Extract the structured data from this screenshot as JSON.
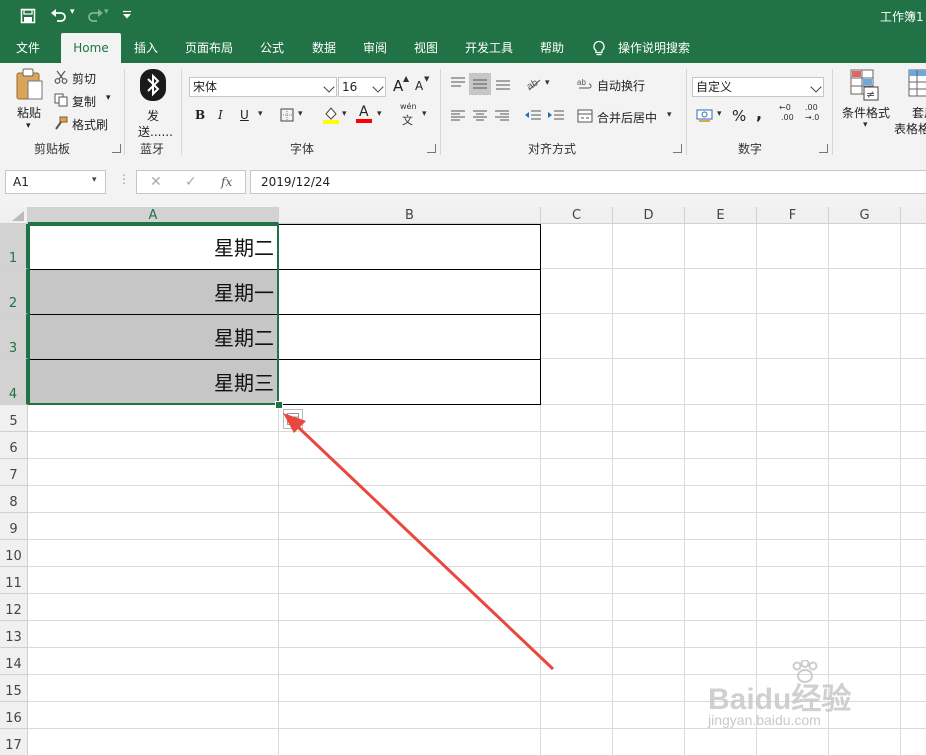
{
  "window": {
    "title": "工作簿1"
  },
  "quick_access": {
    "save_icon": "save-icon",
    "undo_icon": "undo-icon",
    "redo_icon": "redo-icon",
    "customize_icon": "customize-qat-icon"
  },
  "tabs": [
    {
      "label": "文件"
    },
    {
      "label": "Home"
    },
    {
      "label": "插入"
    },
    {
      "label": "页面布局"
    },
    {
      "label": "公式"
    },
    {
      "label": "数据"
    },
    {
      "label": "审阅"
    },
    {
      "label": "视图"
    },
    {
      "label": "开发工具"
    },
    {
      "label": "帮助"
    }
  ],
  "tell_me": {
    "label": "操作说明搜索",
    "icon": "lightbulb-icon"
  },
  "ribbon": {
    "clipboard": {
      "paste": "粘贴",
      "cut": "剪切",
      "copy": "复制",
      "format_painter": "格式刷",
      "group_label": "剪贴板"
    },
    "bluetooth": {
      "send_line1": "发",
      "send_line2": "送......",
      "group_label": "蓝牙"
    },
    "font": {
      "font_name": "宋体",
      "font_size": "16",
      "grow": "A",
      "shrink": "A",
      "bold": "B",
      "italic": "I",
      "underline": "U",
      "font_color_letter": "A",
      "phonetic_top": "wén",
      "phonetic_bottom": "文",
      "group_label": "字体",
      "fill_color": "#ffff00",
      "font_color": "#ff0000"
    },
    "alignment": {
      "wrap_text": "自动换行",
      "merge_center": "合并后居中",
      "group_label": "对齐方式"
    },
    "number": {
      "format": "自定义",
      "percent": "%",
      "comma": ",",
      "inc_decimal_top": "←0",
      "inc_decimal_bottom": ".00",
      "dec_decimal_top": ".00",
      "dec_decimal_bottom": "→.0",
      "group_label": "数字"
    },
    "styles": {
      "conditional_format": "条件格式",
      "format_as_table_line1": "套用",
      "format_as_table_line2": "表格格"
    }
  },
  "formula_bar": {
    "name_box": "A1",
    "cancel": "✕",
    "enter": "✓",
    "fx": "fx",
    "value": "2019/12/24"
  },
  "sheet": {
    "columns": [
      "A",
      "B",
      "C",
      "D",
      "E",
      "F",
      "G"
    ],
    "rows": [
      "1",
      "2",
      "3",
      "4",
      "5",
      "6",
      "7",
      "8",
      "9",
      "10",
      "11",
      "12",
      "13",
      "14",
      "15",
      "16",
      "17"
    ],
    "cells": {
      "A1": "星期二",
      "A2": "星期一",
      "A3": "星期二",
      "A4": "星期三"
    }
  },
  "watermark": {
    "brand": "Baidu经验",
    "url": "jingyan.baidu.com"
  },
  "colors": {
    "accent": "#217346",
    "selection_fill": "#c6c6c6",
    "arrow": "#e8483d"
  }
}
